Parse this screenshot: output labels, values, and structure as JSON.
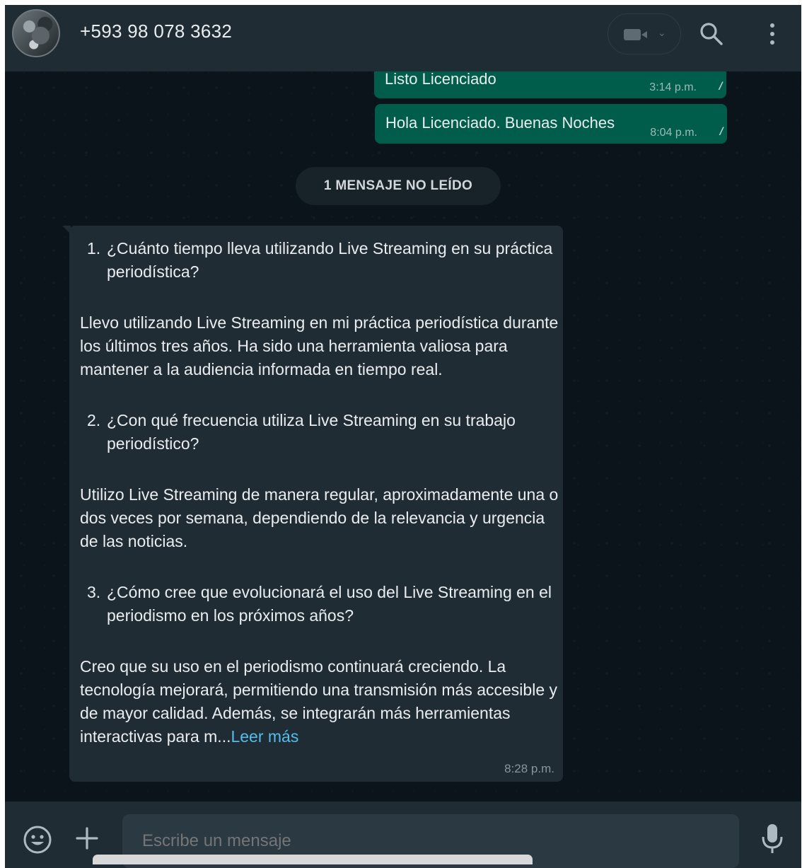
{
  "header": {
    "contact_name": "+593 98 078 3632"
  },
  "messages": {
    "outgoing": [
      {
        "text": "Listo Licenciado",
        "time": "3:14 p.m.",
        "status": "read"
      },
      {
        "text": "Hola Licenciado. Buenas Noches",
        "time": "8:04 p.m.",
        "status": "read"
      }
    ],
    "unread_divider": "1 MENSAJE NO LEÍDO",
    "incoming": {
      "q1_num": "1.",
      "q1": "¿Cuánto tiempo lleva utilizando Live Streaming en su práctica periodística?",
      "a1": "Llevo utilizando Live Streaming en mi práctica periodística durante los últimos tres años. Ha sido una herramienta valiosa para mantener a la audiencia informada en tiempo real.",
      "q2_num": "2.",
      "q2": "¿Con qué frecuencia utiliza Live Streaming en su trabajo periodístico?",
      "a2": "Utilizo Live Streaming de manera regular, aproximadamente una o dos veces por semana, dependiendo de la relevancia y urgencia de las noticias.",
      "q3_num": "3.",
      "q3": "¿Cómo cree que evolucionará el uso del Live Streaming en el periodismo en los próximos años?",
      "a3": "Creo que su uso en el periodismo continuará creciendo. La tecnología mejorará, permitiendo una transmisión más accesible y de mayor calidad. Además, se integrarán más herramientas interactivas para m...",
      "read_more": "Leer más",
      "time": "8:28 p.m."
    }
  },
  "composer": {
    "placeholder": "Escribe un mensaje"
  },
  "icons": {
    "video_call": "video-call-icon",
    "search": "search-icon",
    "menu": "menu-icon",
    "emoji": "emoji-icon",
    "attach": "plus-icon",
    "mic": "mic-icon"
  },
  "colors": {
    "outgoing_bubble": "#005c4b",
    "incoming_bubble": "#202c33",
    "link": "#53bdeb",
    "background": "#0b141a"
  }
}
